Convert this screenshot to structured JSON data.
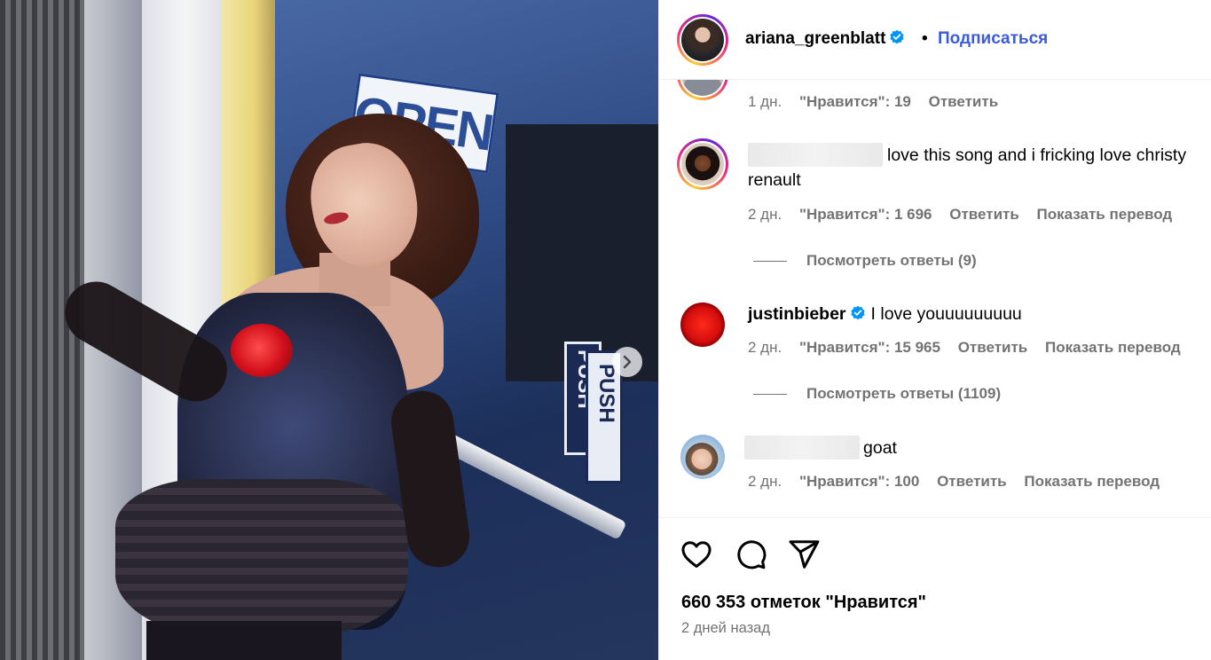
{
  "post": {
    "author": "ariana_greenblatt",
    "separator": "•",
    "follow_label": "Подписаться",
    "photo_text": {
      "sign": "OPEN",
      "door_sign_1": "PUSH",
      "door_sign_2": "PUSH"
    },
    "next_icon": "chevron-right-icon",
    "likes_label": "660 353 отметок \"Нравится\"",
    "date_label": "2 дней назад"
  },
  "comments": [
    {
      "time": "1 дн.",
      "likes": "\"Нравится\": 19",
      "reply": "Ответить"
    },
    {
      "text": "love this song and i fricking love christy renault",
      "time": "2 дн.",
      "likes": "\"Нравится\": 1 696",
      "reply": "Ответить",
      "translate": "Показать перевод",
      "view_replies": "Посмотреть ответы (9)"
    },
    {
      "username": "justinbieber",
      "text": "I love youuuuuuuuu",
      "time": "2 дн.",
      "likes": "\"Нравится\": 15 965",
      "reply": "Ответить",
      "translate": "Показать перевод",
      "view_replies": "Посмотреть ответы (1109)"
    },
    {
      "text": "goat",
      "time": "2 дн.",
      "likes": "\"Нравится\": 100",
      "reply": "Ответить",
      "translate": "Показать перевод"
    }
  ],
  "icons": {
    "like": "heart-icon",
    "comment": "comment-icon",
    "share": "share-icon",
    "verified": "verified-badge-icon"
  },
  "colors": {
    "link": "#3b5bdb",
    "verified": "#0095f6",
    "muted": "#737373"
  }
}
